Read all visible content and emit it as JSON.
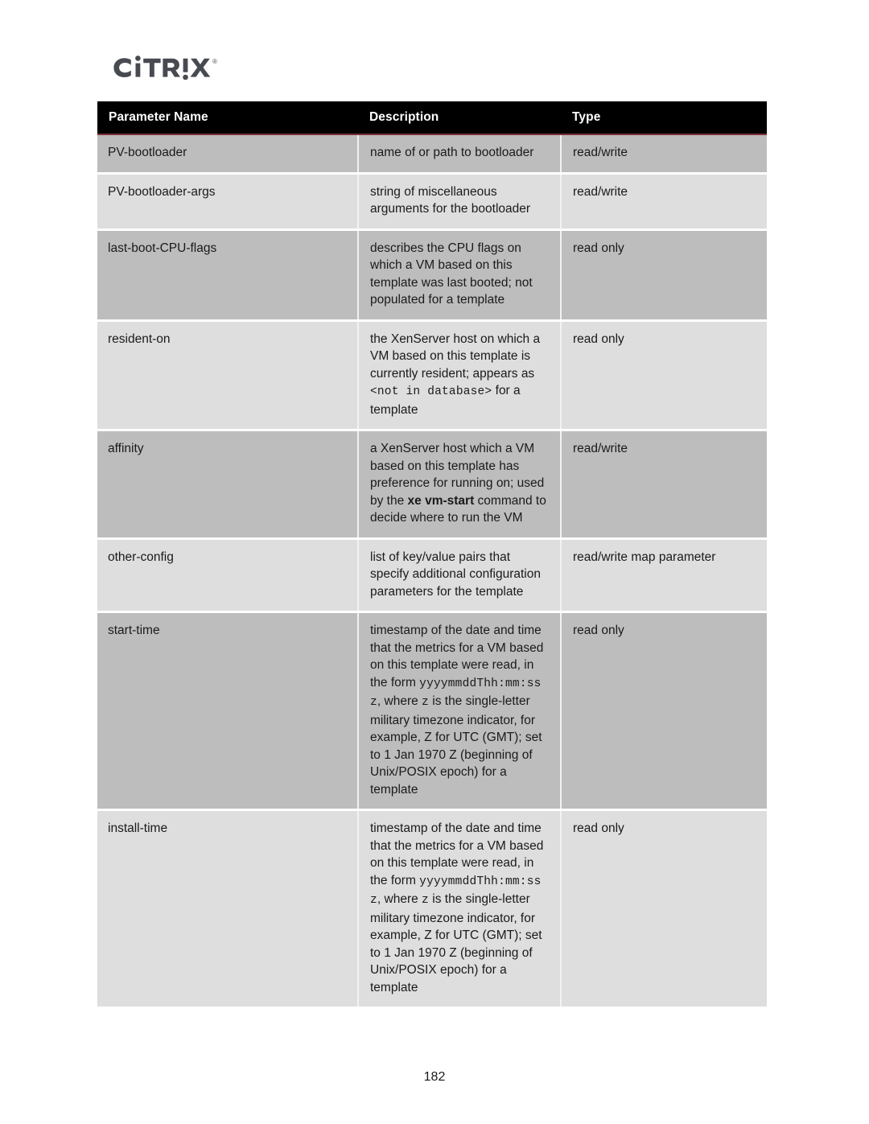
{
  "brand": {
    "logo_text": "CITRIX",
    "logo_mark": "citrix-logo",
    "trademark": "®"
  },
  "table": {
    "name": "vm-template-parameters-table",
    "columns": [
      {
        "label": "Parameter Name"
      },
      {
        "label": "Description"
      },
      {
        "label": "Type"
      }
    ],
    "rows": [
      {
        "parameter": "PV-bootloader",
        "description_parts": [
          {
            "text": "name of or path to bootloader",
            "style": "plain"
          }
        ],
        "type": "read/write"
      },
      {
        "parameter": "PV-bootloader-args",
        "description_parts": [
          {
            "text": "string of miscellaneous arguments for the bootloader",
            "style": "plain"
          }
        ],
        "type": "read/write"
      },
      {
        "parameter": "last-boot-CPU-flags",
        "description_parts": [
          {
            "text": "describes the CPU flags on which a VM based on this template was last booted; not populated for a template",
            "style": "plain"
          }
        ],
        "type": "read only"
      },
      {
        "parameter": "resident-on",
        "description_parts": [
          {
            "text": "the XenServer host on which a VM based on this template is currently resident; appears as ",
            "style": "plain"
          },
          {
            "text": "<not in database>",
            "style": "mono"
          },
          {
            "text": " for a template",
            "style": "plain"
          }
        ],
        "type": "read only"
      },
      {
        "parameter": "affinity",
        "description_parts": [
          {
            "text": "a XenServer host which a VM based on this template has preference for running on; used by the ",
            "style": "plain"
          },
          {
            "text": "xe vm-start",
            "style": "bold"
          },
          {
            "text": " command to decide where to run the VM",
            "style": "plain"
          }
        ],
        "type": "read/write"
      },
      {
        "parameter": "other-config",
        "description_parts": [
          {
            "text": "list of key/value pairs that specify additional configuration parameters for the template",
            "style": "plain"
          }
        ],
        "type": "read/write map parameter"
      },
      {
        "parameter": "start-time",
        "description_parts": [
          {
            "text": "timestamp of the date and time that the metrics for a VM based on this template were read, in the form ",
            "style": "plain"
          },
          {
            "text": "yyyymmddThh:mm:ss z",
            "style": "mono"
          },
          {
            "text": ", where ",
            "style": "plain"
          },
          {
            "text": "z",
            "style": "mono"
          },
          {
            "text": " is the single-letter military timezone indicator, for example, Z for UTC (GMT); set to 1 Jan 1970 Z (beginning of Unix/POSIX epoch) for a template",
            "style": "plain"
          }
        ],
        "type": "read only"
      },
      {
        "parameter": "install-time",
        "description_parts": [
          {
            "text": "timestamp of the date and time that the metrics for a VM based on this template were read, in the form ",
            "style": "plain"
          },
          {
            "text": "yyyymmddThh:mm:ss z",
            "style": "mono"
          },
          {
            "text": ", where ",
            "style": "plain"
          },
          {
            "text": "z",
            "style": "mono"
          },
          {
            "text": " is the single-letter military timezone indicator, for example, Z for UTC (GMT); set to 1 Jan 1970 Z (beginning of Unix/POSIX epoch) for a template",
            "style": "plain"
          }
        ],
        "type": "read only"
      }
    ]
  },
  "footer": {
    "page_number": "182"
  },
  "colors": {
    "header_background": "#000000",
    "header_text": "#ffffff",
    "header_accent_rule": "#7a3038",
    "row_shade_dark": "#bdbdbd",
    "row_shade_light": "#dedede",
    "logo": "#484a52",
    "body_text": "#1a1a1a",
    "page_background": "#ffffff"
  }
}
